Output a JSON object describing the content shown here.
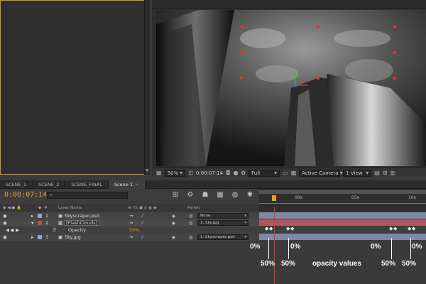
{
  "viewer_toolbar": {
    "zoom": "50%",
    "timecode": "0:00:07:14",
    "resolution": "Full",
    "camera": "Active Camera",
    "view": "1 View"
  },
  "tabs": [
    {
      "label": "SCENE_1",
      "active": false
    },
    {
      "label": "SCENE_2",
      "active": false
    },
    {
      "label": "SCENE_FINAL",
      "active": false
    },
    {
      "label": "Scene-1",
      "active": true
    }
  ],
  "timeline": {
    "current_time": "0:00:07:14",
    "search_placeholder": "",
    "ruler_labels": [
      "00s",
      "05s",
      "10s"
    ],
    "columns": {
      "layer_name": "Layer Name",
      "parent": "Parent"
    },
    "layers": [
      {
        "num": "1",
        "name": "Skyscraper.psd",
        "color": "#9aa3c7",
        "parent": "None",
        "selected": false
      },
      {
        "num": "2",
        "name": "[FlashClouds]",
        "color": "#c2474f",
        "parent": "3. Sky.jpg",
        "selected": true
      },
      {
        "num": "3",
        "name": "Sky.jpg",
        "color": "#9aa3c7",
        "parent": "1. Skyscraper.psd",
        "selected": false
      }
    ],
    "property": {
      "name": "Opacity",
      "value": "50%"
    }
  },
  "annotations": {
    "labels_top": [
      "0%",
      "0%",
      "0%",
      "0%"
    ],
    "labels_bottom": [
      "50%",
      "50%",
      "50%",
      "50%"
    ],
    "caption": "opacity values"
  },
  "colors": {
    "accent": "#e39a23",
    "playhead": "#d9382e",
    "panel_border": "#c79a2b"
  }
}
